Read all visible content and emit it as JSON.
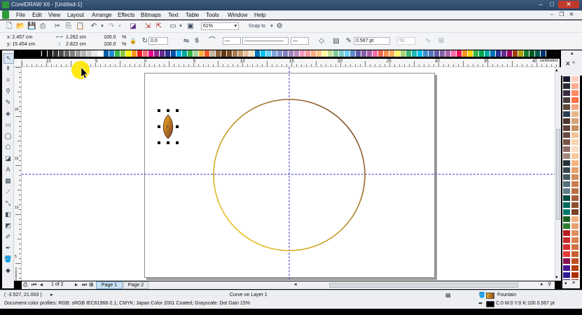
{
  "titlebar": {
    "title": "CorelDRAW X6 - [Untitled-1]",
    "minimize": "–",
    "maximize": "□",
    "close": "✕"
  },
  "menu": [
    "File",
    "Edit",
    "View",
    "Layout",
    "Arrange",
    "Effects",
    "Bitmaps",
    "Text",
    "Table",
    "Tools",
    "Window",
    "Help"
  ],
  "mdi": {
    "minimize": "–",
    "restore": "❐",
    "close": "✕"
  },
  "toolbar": {
    "zoom_level": "61%",
    "snap_to": "Snap to"
  },
  "property_bar": {
    "x": "x: 2.457 cm",
    "y": "y: 15.454 cm",
    "width": "1.262 cm",
    "height": "2.822 cm",
    "scale_x": "100.0",
    "scale_y": "100.0",
    "pct1": "%",
    "pct2": "%",
    "rotation": "0.0",
    "outline_width": "0.567 pt",
    "size_value": "50"
  },
  "rulers": {
    "top_labels": [
      "10",
      "5",
      "0",
      "5",
      "10",
      "15",
      "20",
      "25",
      "30",
      "35",
      "40",
      "45"
    ],
    "unit": "centimeters",
    "left_labels": [
      "20",
      "15",
      "10",
      "5"
    ],
    "left_unit": "centimeters"
  },
  "pager": {
    "page_count": "1 of 2",
    "tabs": [
      "Page 1",
      "Page 2"
    ]
  },
  "status": {
    "cursor": "( -3.527, 21.003 )",
    "object": "Curve on Layer 1",
    "fill_name": "Fountain",
    "outline_info": "C:0 M:0 Y:0 K:100  0.567 pt",
    "color_profiles": "Document color profiles: RGB: sRGB IEC61966-2.1; CMYK: Japan Color 2001 Coated; Grayscale: Dot Gain 15%"
  },
  "colors": {
    "title_bg": "#2b4566",
    "page_tab_active": "#c9e1f6",
    "circle_gold": "#e8c21e",
    "circle_brown": "#7a4a2a",
    "guide": "#3a3acf",
    "cursor_highlight": "#ffe600"
  }
}
